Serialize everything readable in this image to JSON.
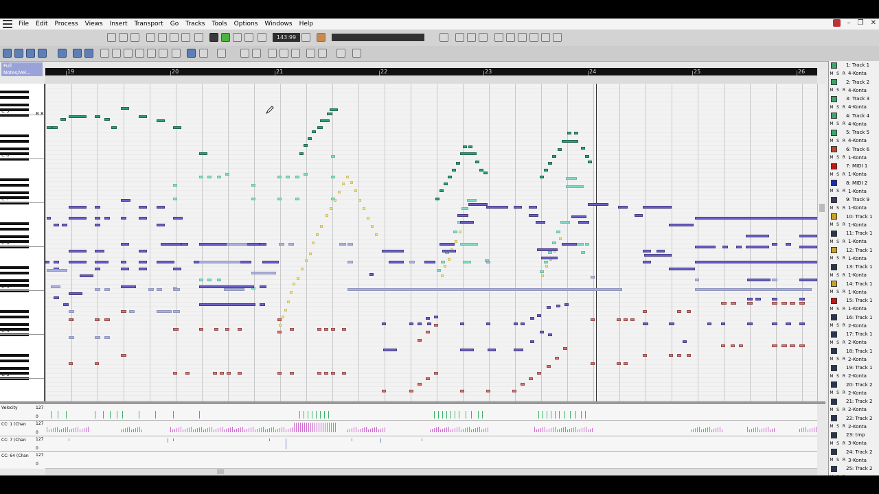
{
  "menu": [
    "File",
    "Edit",
    "Process",
    "Views",
    "Insert",
    "Transport",
    "Go",
    "Tracks",
    "Tools",
    "Options",
    "Windows",
    "Help"
  ],
  "transport": {
    "time": "143:99"
  },
  "snap": {
    "grid": "Full",
    "mode": "Notes/Vel..."
  },
  "ruler": {
    "bars": [
      "19",
      "20",
      "21",
      "22",
      "23",
      "24",
      "25",
      "26"
    ]
  },
  "piano": {
    "octave_labels": [
      "C 9",
      "C 8",
      "C 7",
      "C 6",
      "C 5",
      "C 4",
      "C 3"
    ],
    "marker": "B 8"
  },
  "lanes": [
    {
      "label": "Velocity",
      "max": "127",
      "min": "0"
    },
    {
      "label": "CC: 1 (Chan",
      "max": "127",
      "min": "0"
    },
    {
      "label": "CC: 7 (Chan",
      "max": "127",
      "min": "0"
    },
    {
      "label": "CC: 64 (Chan",
      "max": "127",
      "min": "0"
    }
  ],
  "track_list": [
    {
      "name": "1: Track 1",
      "inst": "4-Konta",
      "color": "#3aa86b"
    },
    {
      "name": "2: Track 2",
      "inst": "4-Konta",
      "color": "#3aa86b"
    },
    {
      "name": "3: Track 3",
      "inst": "4-Konta",
      "color": "#3aa86b"
    },
    {
      "name": "4: Track 4",
      "inst": "4-Konta",
      "color": "#3aa86b"
    },
    {
      "name": "5: Track 5",
      "inst": "4-Konta",
      "color": "#3aa86b"
    },
    {
      "name": "6: Track 6",
      "inst": "1-Konta",
      "color": "#c0472e"
    },
    {
      "name": "7: MIDI 1",
      "inst": "1-Konta",
      "color": "#c01818"
    },
    {
      "name": "8: MIDI 2",
      "inst": "1-Konta",
      "color": "#1a2fb0"
    },
    {
      "name": "9: Track 9",
      "inst": "1-Konta",
      "color": "#3a3a5a"
    },
    {
      "name": "10: Track 1",
      "inst": "1-Konta",
      "color": "#c9a227"
    },
    {
      "name": "11: Track 1",
      "inst": "1-Konta",
      "color": "#2a3550"
    },
    {
      "name": "12: Track 1",
      "inst": "1-Konta",
      "color": "#c9a227"
    },
    {
      "name": "13: Track 1",
      "inst": "1-Konta",
      "color": "#2a3550"
    },
    {
      "name": "14: Track 1",
      "inst": "1-Konta",
      "color": "#c9a227"
    },
    {
      "name": "15: Track 1",
      "inst": "1-Konta",
      "color": "#c01818"
    },
    {
      "name": "16: Track 1",
      "inst": "2-Konta",
      "color": "#2a3550"
    },
    {
      "name": "17: Track 1",
      "inst": "2-Konta",
      "color": "#2a3550"
    },
    {
      "name": "18: Track 1",
      "inst": "2-Konta",
      "color": "#2a3550"
    },
    {
      "name": "19: Track 1",
      "inst": "2-Konta",
      "color": "#2a3550"
    },
    {
      "name": "20: Track 2",
      "inst": "2-Konta",
      "color": "#2a3550"
    },
    {
      "name": "21: Track 2",
      "inst": "2-Konta",
      "color": "#2a3550"
    },
    {
      "name": "22: Track 2",
      "inst": "2-Konta",
      "color": "#2a3550"
    },
    {
      "name": "23: tmp",
      "inst": "3-Konta",
      "color": "#2a3550"
    },
    {
      "name": "24: Track 2",
      "inst": "3-Konta",
      "color": "#2a3550"
    },
    {
      "name": "25: Track 2",
      "inst": "",
      "color": "#2a3550"
    }
  ],
  "note_colors": {
    "green": "#2f9e77",
    "mint": "#7fdcc4",
    "yellow": "#f2e27a",
    "purple": "#6a5fc9",
    "lilac": "#a9b0dd",
    "red": "#e07070"
  }
}
